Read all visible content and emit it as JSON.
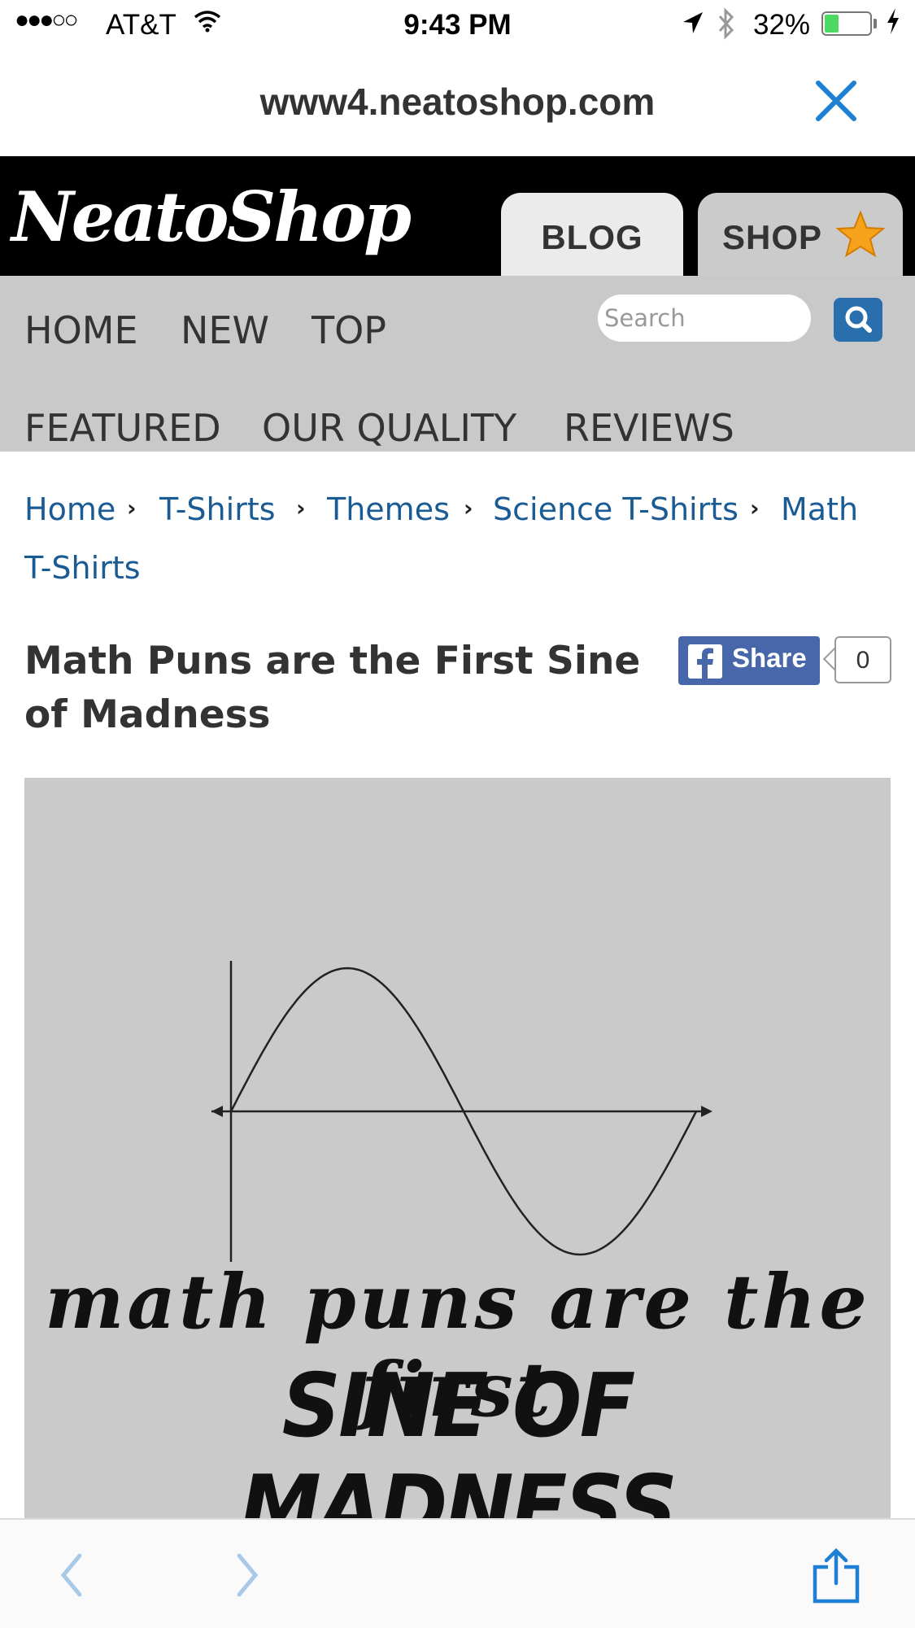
{
  "status_bar": {
    "signal": "●●●○○",
    "carrier": "AT&T",
    "time": "9:43 PM",
    "battery_percent": "32%",
    "battery_level": 0.32,
    "icons": [
      "wifi-icon",
      "location-arrow-icon",
      "bluetooth-icon",
      "battery-icon",
      "charging-bolt-icon"
    ]
  },
  "address_bar": {
    "url": "www4.neatoshop.com",
    "close_icon": "close-icon"
  },
  "header": {
    "logo_text": "NeatoShop",
    "tabs": [
      {
        "label": "BLOG"
      },
      {
        "label": "SHOP"
      }
    ],
    "shop_icon": "star-icon",
    "colors": {
      "background": "#000000",
      "star": "#f7a21b"
    }
  },
  "nav": {
    "row1": [
      "HOME",
      "NEW",
      "TOP"
    ],
    "row2": [
      "FEATURED",
      "OUR QUALITY",
      "REVIEWS"
    ],
    "search_placeholder": "Search",
    "search_icon": "search-icon",
    "colors": {
      "background": "#c9c9c9",
      "search_button": "#2a6fad"
    }
  },
  "breadcrumb": {
    "items": [
      "Home",
      "T-Shirts",
      "Themes",
      "Science T-Shirts",
      "Math",
      "T-Shirts"
    ],
    "separator": "›"
  },
  "product": {
    "title_line1": "Math Puns are the First Sine",
    "title_line2": "of Madness",
    "share_label": "Share",
    "share_count": "0",
    "image": {
      "tagline_line1": "math puns are the first",
      "tagline_line2": "SINE OF MADNESS",
      "graphic": "sine-wave-graph"
    }
  },
  "toolbar": {
    "icons": [
      "back-arrow-icon",
      "forward-arrow-icon",
      "share-icon"
    ]
  }
}
